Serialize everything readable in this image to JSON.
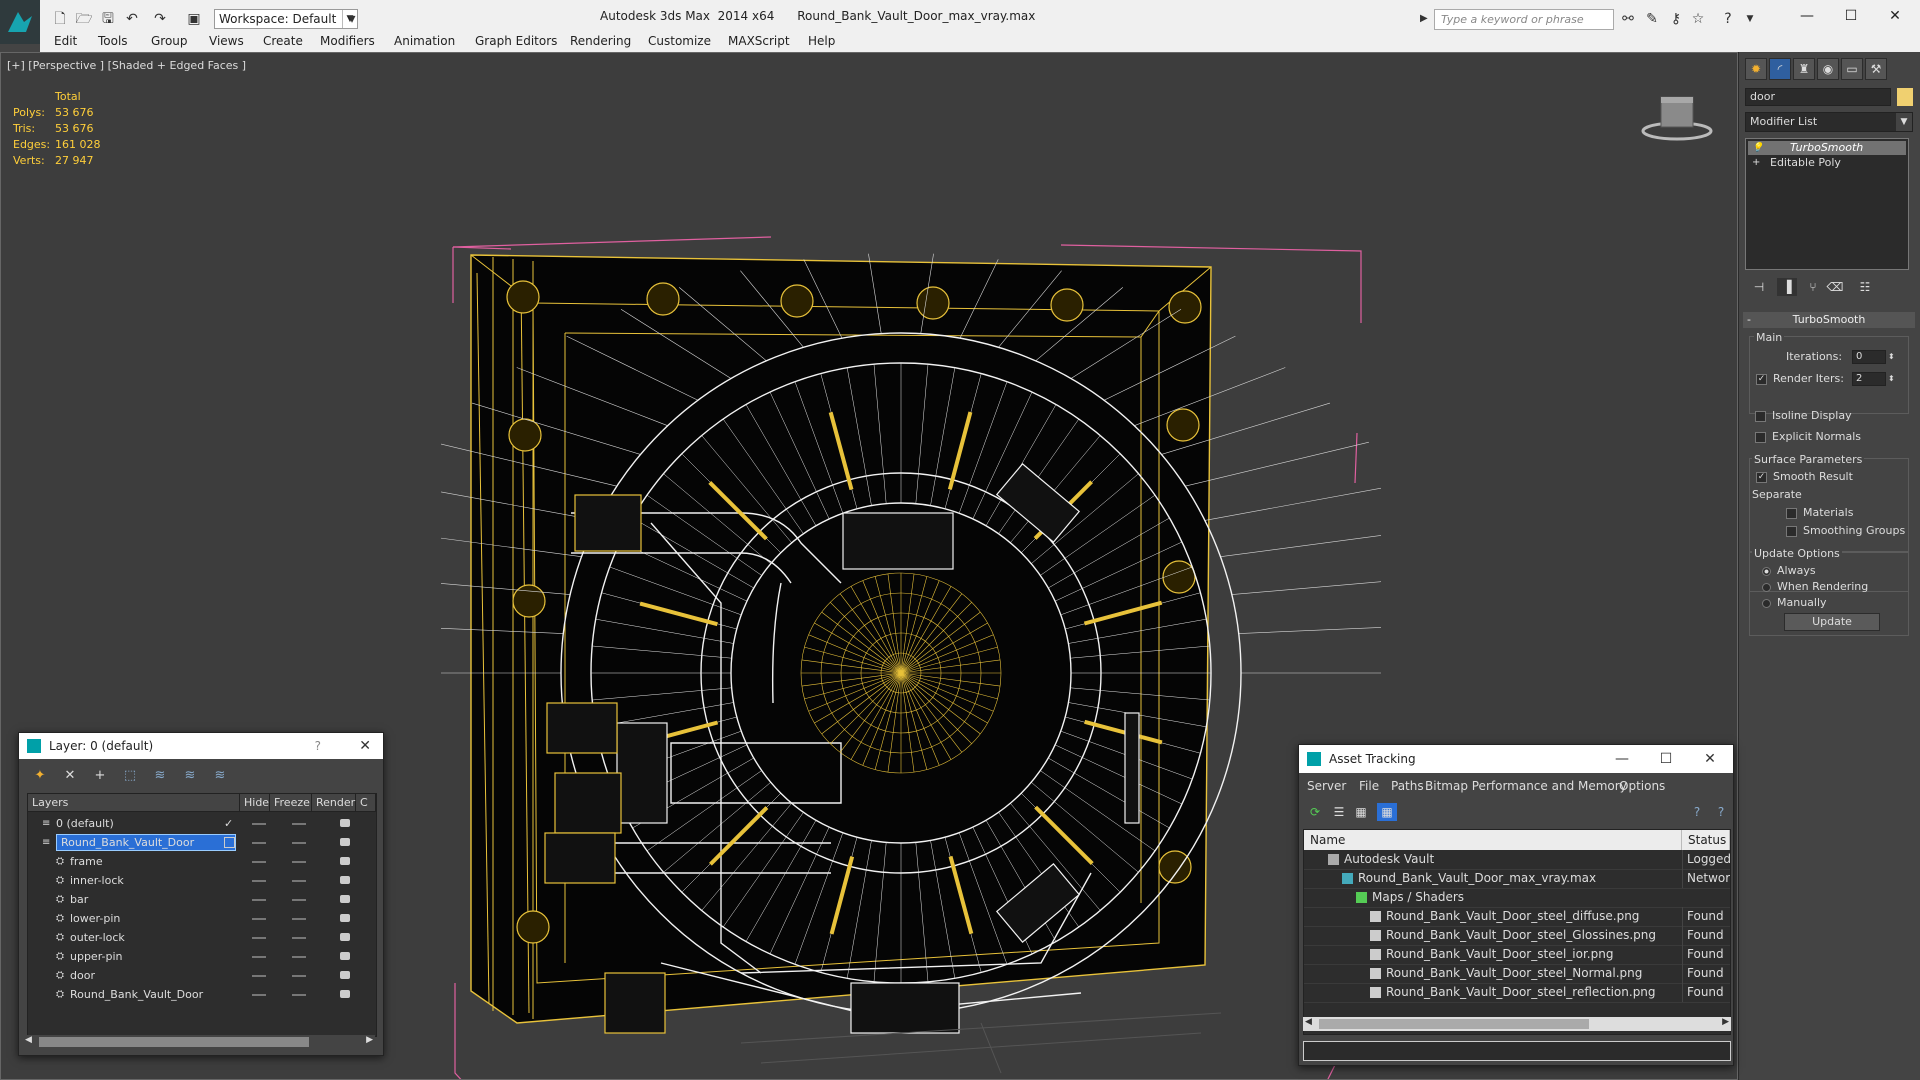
{
  "titlebar": {
    "workspace": "Workspace: Default",
    "app": "Autodesk 3ds Max  2014 x64",
    "file": "Round_Bank_Vault_Door_max_vray.max",
    "search_placeholder": "Type a keyword or phrase"
  },
  "menu": [
    "Edit",
    "Tools",
    "Group",
    "Views",
    "Create",
    "Modifiers",
    "Animation",
    "Graph Editors",
    "Rendering",
    "Customize",
    "MAXScript",
    "Help"
  ],
  "viewport": {
    "label": "[+] [Perspective ] [Shaded + Edged Faces ]",
    "stats": {
      "header": "Total",
      "rows": [
        {
          "label": "Polys:",
          "value": "53 676"
        },
        {
          "label": "Tris:",
          "value": "53 676"
        },
        {
          "label": "Edges:",
          "value": "161 028"
        },
        {
          "label": "Verts:",
          "value": "27 947"
        }
      ]
    }
  },
  "command_panel": {
    "object_name": "door",
    "object_color": "#f0d070",
    "modifier_list": "Modifier List",
    "stack": [
      "TurboSmooth",
      "Editable Poly"
    ],
    "rollout_title": "TurboSmooth",
    "main_group": "Main",
    "iterations_label": "Iterations:",
    "iterations_value": "0",
    "render_iters_label": "Render Iters:",
    "render_iters_value": "2",
    "isoline": "Isoline Display",
    "explicit_normals": "Explicit Normals",
    "surface_group": "Surface Parameters",
    "smooth_result": "Smooth Result",
    "separate": "Separate",
    "materials": "Materials",
    "smoothing_groups": "Smoothing Groups",
    "update_group": "Update Options",
    "always": "Always",
    "when_rendering": "When Rendering",
    "manually": "Manually",
    "update_button": "Update"
  },
  "layer_window": {
    "title": "Layer: 0 (default)",
    "help": "?",
    "columns": {
      "layers": "Layers",
      "hide": "Hide",
      "freeze": "Freeze",
      "render": "Render",
      "extra": "C"
    },
    "rows": [
      {
        "name": "0 (default)",
        "indent": 0
      },
      {
        "name": "Round_Bank_Vault_Door",
        "indent": 0
      },
      {
        "name": "frame",
        "indent": 1
      },
      {
        "name": "inner-lock",
        "indent": 1
      },
      {
        "name": "bar",
        "indent": 1
      },
      {
        "name": "lower-pin",
        "indent": 1
      },
      {
        "name": "outer-lock",
        "indent": 1
      },
      {
        "name": "upper-pin",
        "indent": 1
      },
      {
        "name": "door",
        "indent": 1
      },
      {
        "name": "Round_Bank_Vault_Door",
        "indent": 1
      }
    ]
  },
  "asset_window": {
    "title": "Asset Tracking",
    "menu": [
      "Server",
      "File",
      "Paths",
      "Bitmap Performance and Memory",
      "Options"
    ],
    "columns": {
      "name": "Name",
      "status": "Status"
    },
    "rows": [
      {
        "name": "Autodesk Vault",
        "status": "Logged Out",
        "indent": 1
      },
      {
        "name": "Round_Bank_Vault_Door_max_vray.max",
        "status": "Network",
        "indent": 2
      },
      {
        "name": "Maps / Shaders",
        "status": "",
        "indent": 3
      },
      {
        "name": "Round_Bank_Vault_Door_steel_diffuse.png",
        "status": "Found",
        "indent": 4
      },
      {
        "name": "Round_Bank_Vault_Door_steel_Glossines.png",
        "status": "Found",
        "indent": 4
      },
      {
        "name": "Round_Bank_Vault_Door_steel_ior.png",
        "status": "Found",
        "indent": 4
      },
      {
        "name": "Round_Bank_Vault_Door_steel_Normal.png",
        "status": "Found",
        "indent": 4
      },
      {
        "name": "Round_Bank_Vault_Door_steel_reflection.png",
        "status": "Found",
        "indent": 4
      }
    ]
  },
  "colors": {
    "wire_yellow": "#e8c23a",
    "wire_white": "#f2f2f2",
    "bbox_pink": "#e060a0",
    "selection": "#2a6fd6"
  }
}
